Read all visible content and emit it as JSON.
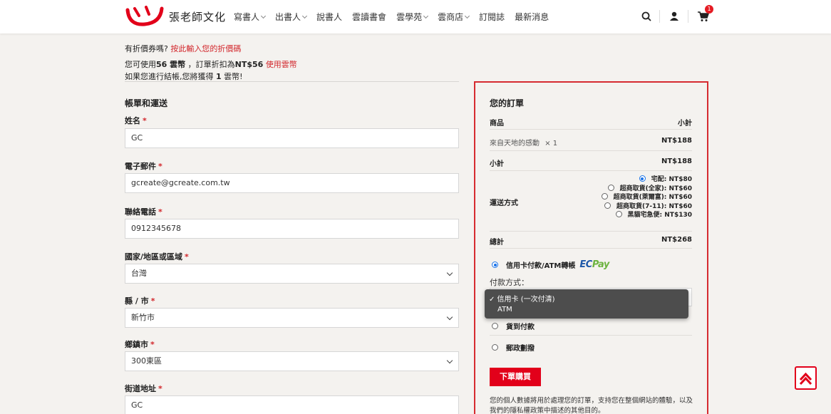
{
  "brand": {
    "logo_text": "張老師文化",
    "accent_color": "#e2001a"
  },
  "nav": {
    "items": [
      {
        "label": "寫書人",
        "has_dropdown": true
      },
      {
        "label": "出書人",
        "has_dropdown": true
      },
      {
        "label": "說書人",
        "has_dropdown": false
      },
      {
        "label": "雲讀書會",
        "has_dropdown": false
      },
      {
        "label": "雲學苑",
        "has_dropdown": true
      },
      {
        "label": "雲商店",
        "has_dropdown": true
      },
      {
        "label": "訂閱誌",
        "has_dropdown": false
      },
      {
        "label": "最新消息",
        "has_dropdown": false
      }
    ],
    "cart_count": "1",
    "icons": [
      "search-icon",
      "user-icon",
      "cart-icon"
    ]
  },
  "notices": {
    "coupon_prefix": "有折價券嗎?",
    "coupon_link": "按此輸入您的折價碼",
    "points_a": "您可使用",
    "points_amount": "56 雲幣",
    "points_b": "，訂單折扣為",
    "points_discount": "NT$56",
    "points_link": "使用雲幣",
    "earn_prefix": "如果您進行結帳,您將獲得",
    "earn_amount": "1",
    "earn_suffix": "雲幣!"
  },
  "billing": {
    "title": "帳單和運送",
    "fields": {
      "name": {
        "label": "姓名",
        "value": "GC"
      },
      "email": {
        "label": "電子郵件",
        "value": "gcreate@gcreate.com.tw"
      },
      "phone": {
        "label": "聯絡電話",
        "value": "0912345678"
      },
      "country": {
        "label": "國家/地區或區域",
        "value": "台灣"
      },
      "county": {
        "label": "縣 / 市",
        "value": "新竹市"
      },
      "town": {
        "label": "鄉鎮市",
        "value": "300東區"
      },
      "address": {
        "label": "街道地址",
        "value": "GC"
      }
    }
  },
  "order": {
    "title": "您的訂單",
    "col_product": "商品",
    "col_subtotal": "小計",
    "item_name": "來自天地的感動",
    "item_qty": "× 1",
    "item_price": "NT$188",
    "subtotal_label": "小計",
    "subtotal_value": "NT$188",
    "shipping_label": "運送方式",
    "shipping_options": [
      {
        "label": "宅配: NT$80",
        "selected": true
      },
      {
        "label": "超商取貨(全家): NT$60",
        "selected": false
      },
      {
        "label": "超商取貨(萊爾富): NT$60",
        "selected": false
      },
      {
        "label": "超商取貨(7-11): NT$60",
        "selected": false
      },
      {
        "label": "黑貓宅急便: NT$130",
        "selected": false
      }
    ],
    "total_label": "總計",
    "total_value": "NT$268"
  },
  "payment": {
    "credit_label": "信用卡付款/ATM轉帳",
    "ecpay_a": "EC",
    "ecpay_b": "Pay",
    "method_label": "付款方式：",
    "dropdown_options": [
      {
        "label": "✓ 信用卡 (一次付清)",
        "selected": true
      },
      {
        "label": "ATM",
        "selected": false
      }
    ],
    "cod_label": "貨到付款",
    "postal_label": "郵政劃撥",
    "submit_label": "下單購買",
    "privacy_text": "您的個人數據將用於處理您的訂單，支持您在整個網站的體驗，以及我們的隱私權政策中描述的其他目的。"
  }
}
